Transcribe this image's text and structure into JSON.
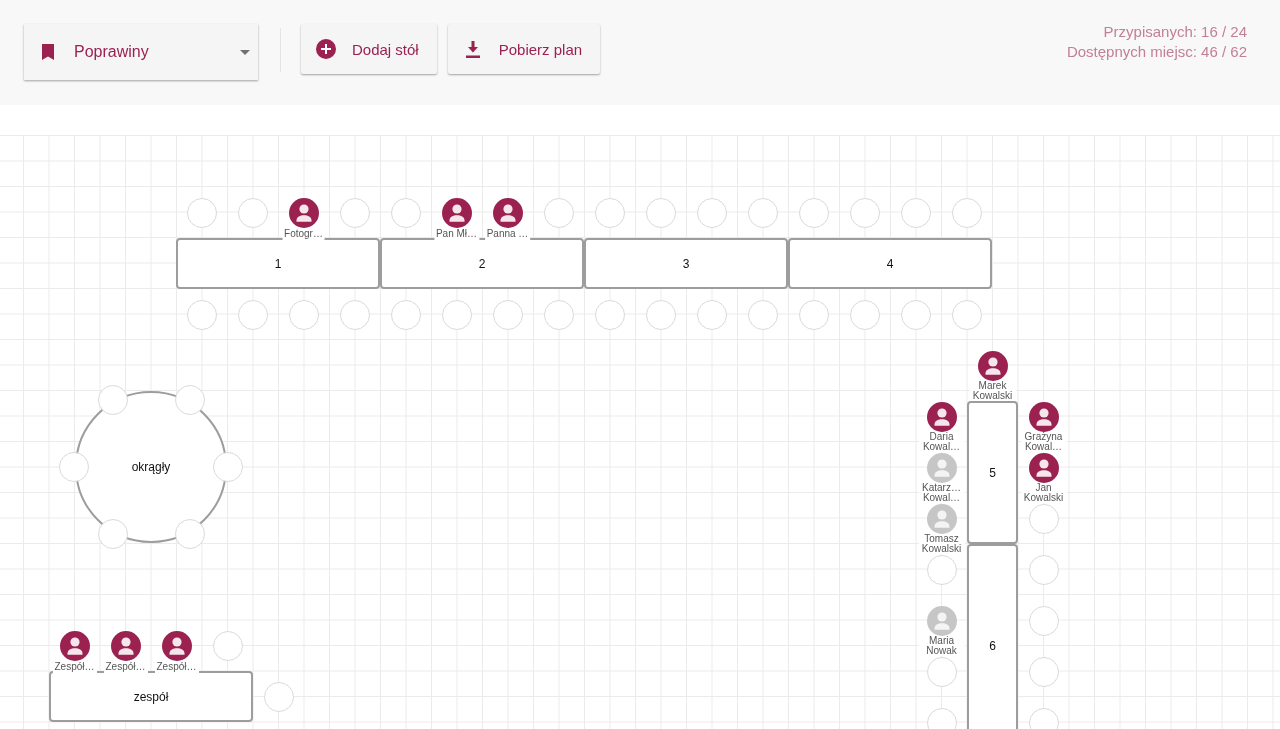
{
  "toolbar": {
    "event_select": {
      "value": "Poprawiny"
    },
    "buttons": [
      {
        "label": "Dodaj stół",
        "kind": "add"
      },
      {
        "label": "Pobierz plan",
        "kind": "download"
      }
    ],
    "stats": [
      "Przypisanych: 16 / 24",
      "Dostępnych miejsc: 46 / 62"
    ]
  },
  "tables": [
    {
      "label": "1",
      "kind": "rect",
      "seats": {
        "top": [
          {
            "kind": "empty"
          },
          {
            "kind": "empty"
          },
          {
            "kind": "guest",
            "name": "Fotogr…",
            "confirmed": true
          },
          {
            "kind": "empty"
          }
        ],
        "bottom": [
          {
            "kind": "empty"
          },
          {
            "kind": "empty"
          },
          {
            "kind": "empty"
          },
          {
            "kind": "empty"
          }
        ]
      }
    },
    {
      "label": "2",
      "kind": "rect",
      "seats": {
        "top": [
          {
            "kind": "empty"
          },
          {
            "kind": "guest",
            "name": "Pan Mł…",
            "confirmed": true
          },
          {
            "kind": "guest",
            "name": "Panna …",
            "confirmed": true
          },
          {
            "kind": "empty"
          }
        ],
        "bottom": [
          {
            "kind": "empty"
          },
          {
            "kind": "empty"
          },
          {
            "kind": "empty"
          },
          {
            "kind": "empty"
          }
        ]
      }
    },
    {
      "label": "3",
      "kind": "rect",
      "seats": {
        "top": [
          {
            "kind": "empty"
          },
          {
            "kind": "empty"
          },
          {
            "kind": "empty"
          },
          {
            "kind": "empty"
          }
        ],
        "bottom": [
          {
            "kind": "empty"
          },
          {
            "kind": "empty"
          },
          {
            "kind": "empty"
          },
          {
            "kind": "empty"
          }
        ]
      }
    },
    {
      "label": "4",
      "kind": "rect",
      "seats": {
        "top": [
          {
            "kind": "empty"
          },
          {
            "kind": "empty"
          },
          {
            "kind": "empty"
          },
          {
            "kind": "empty"
          }
        ],
        "bottom": [
          {
            "kind": "empty"
          },
          {
            "kind": "empty"
          },
          {
            "kind": "empty"
          },
          {
            "kind": "empty"
          }
        ]
      }
    },
    {
      "label": "okrągły",
      "kind": "round",
      "seats": {
        "around": [
          {
            "kind": "empty"
          },
          {
            "kind": "empty"
          },
          {
            "kind": "empty"
          },
          {
            "kind": "empty"
          },
          {
            "kind": "empty"
          },
          {
            "kind": "empty"
          }
        ]
      }
    },
    {
      "label": "5",
      "kind": "rect",
      "seats": {
        "top": [
          {
            "kind": "guest",
            "name": "Marek Kowalski",
            "confirmed": true
          }
        ],
        "left": [
          {
            "kind": "guest",
            "name": "Daria Kowal…",
            "confirmed": true
          },
          {
            "kind": "guest",
            "name": "Katarz… Kowal…",
            "confirmed": false
          },
          {
            "kind": "guest",
            "name": "Tomasz Kowalski",
            "confirmed": false
          }
        ],
        "right": [
          {
            "kind": "guest",
            "name": "Grażyna Kowal…",
            "confirmed": true
          },
          {
            "kind": "guest",
            "name": "Jan Kowalski",
            "confirmed": true
          },
          {
            "kind": "empty"
          }
        ]
      }
    },
    {
      "label": "6",
      "kind": "rect",
      "seats": {
        "left": [
          {
            "kind": "empty"
          },
          {
            "kind": "guest",
            "name": "Maria Nowak",
            "confirmed": false
          },
          {
            "kind": "empty"
          },
          {
            "kind": "empty"
          }
        ],
        "right": [
          {
            "kind": "empty"
          },
          {
            "kind": "empty"
          },
          {
            "kind": "empty"
          },
          {
            "kind": "empty"
          }
        ]
      }
    },
    {
      "label": "zespół",
      "kind": "rect",
      "seats": {
        "top": [
          {
            "kind": "guest",
            "name": "Zespół…",
            "confirmed": true
          },
          {
            "kind": "guest",
            "name": "Zespół…",
            "confirmed": true
          },
          {
            "kind": "guest",
            "name": "Zespół…",
            "confirmed": true
          },
          {
            "kind": "empty"
          }
        ],
        "right": [
          {
            "kind": "empty"
          }
        ]
      }
    }
  ]
}
